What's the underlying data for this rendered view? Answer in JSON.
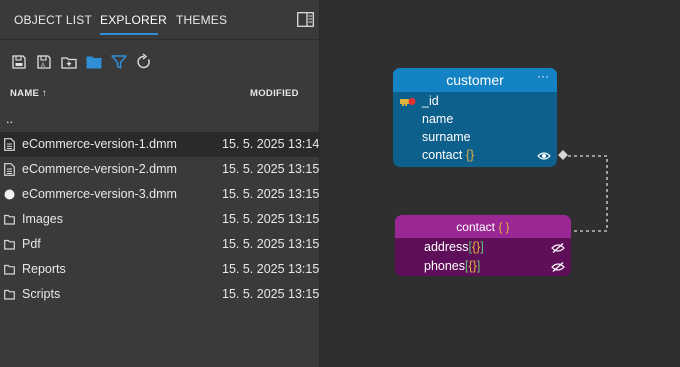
{
  "tabs": [
    {
      "label": "OBJECT LIST"
    },
    {
      "label": "EXPLORER"
    },
    {
      "label": "THEMES"
    }
  ],
  "active_tab": "EXPLORER",
  "columns": {
    "name": "NAME",
    "sort_arrow": "↑",
    "modified": "MODIFIED"
  },
  "files": [
    {
      "name": "..",
      "modified": "",
      "icon": "parent-dir"
    },
    {
      "name": "eCommerce-version-1.dmm",
      "modified": "15. 5. 2025 13:14",
      "icon": "file-icon"
    },
    {
      "name": "eCommerce-version-2.dmm",
      "modified": "15. 5. 2025 13:15",
      "icon": "file-icon"
    },
    {
      "name": "eCommerce-version-3.dmm",
      "modified": "15. 5. 2025 13:15",
      "icon": "unsaved-dot-icon"
    },
    {
      "name": "Images",
      "modified": "15. 5. 2025 13:15",
      "icon": "folder-icon"
    },
    {
      "name": "Pdf",
      "modified": "15. 5. 2025 13:15",
      "icon": "folder-icon"
    },
    {
      "name": "Reports",
      "modified": "15. 5. 2025 13:15",
      "icon": "folder-icon"
    },
    {
      "name": "Scripts",
      "modified": "15. 5. 2025 13:15",
      "icon": "folder-icon"
    }
  ],
  "diagram": {
    "customer": {
      "title": "customer",
      "menu": "···",
      "fields": {
        "id": "_id",
        "name": "name",
        "surname": "surname",
        "contact": "contact",
        "contact_brace": "{}"
      }
    },
    "contact": {
      "title": "contact",
      "title_brace": "{ }",
      "fields": {
        "address": "address",
        "address_brace_open": "[",
        "address_brace_inner": "{}",
        "address_brace_close": "]",
        "phones": "phones",
        "phones_brace_open": "[",
        "phones_brace_inner": "{}",
        "phones_brace_close": "]"
      }
    }
  },
  "colors": {
    "accent": "#2f8fd6",
    "customer_header": "#1483c5",
    "customer_body": "#0d5f8c",
    "contact_header": "#9b2794",
    "contact_body": "#5f0f5a"
  }
}
